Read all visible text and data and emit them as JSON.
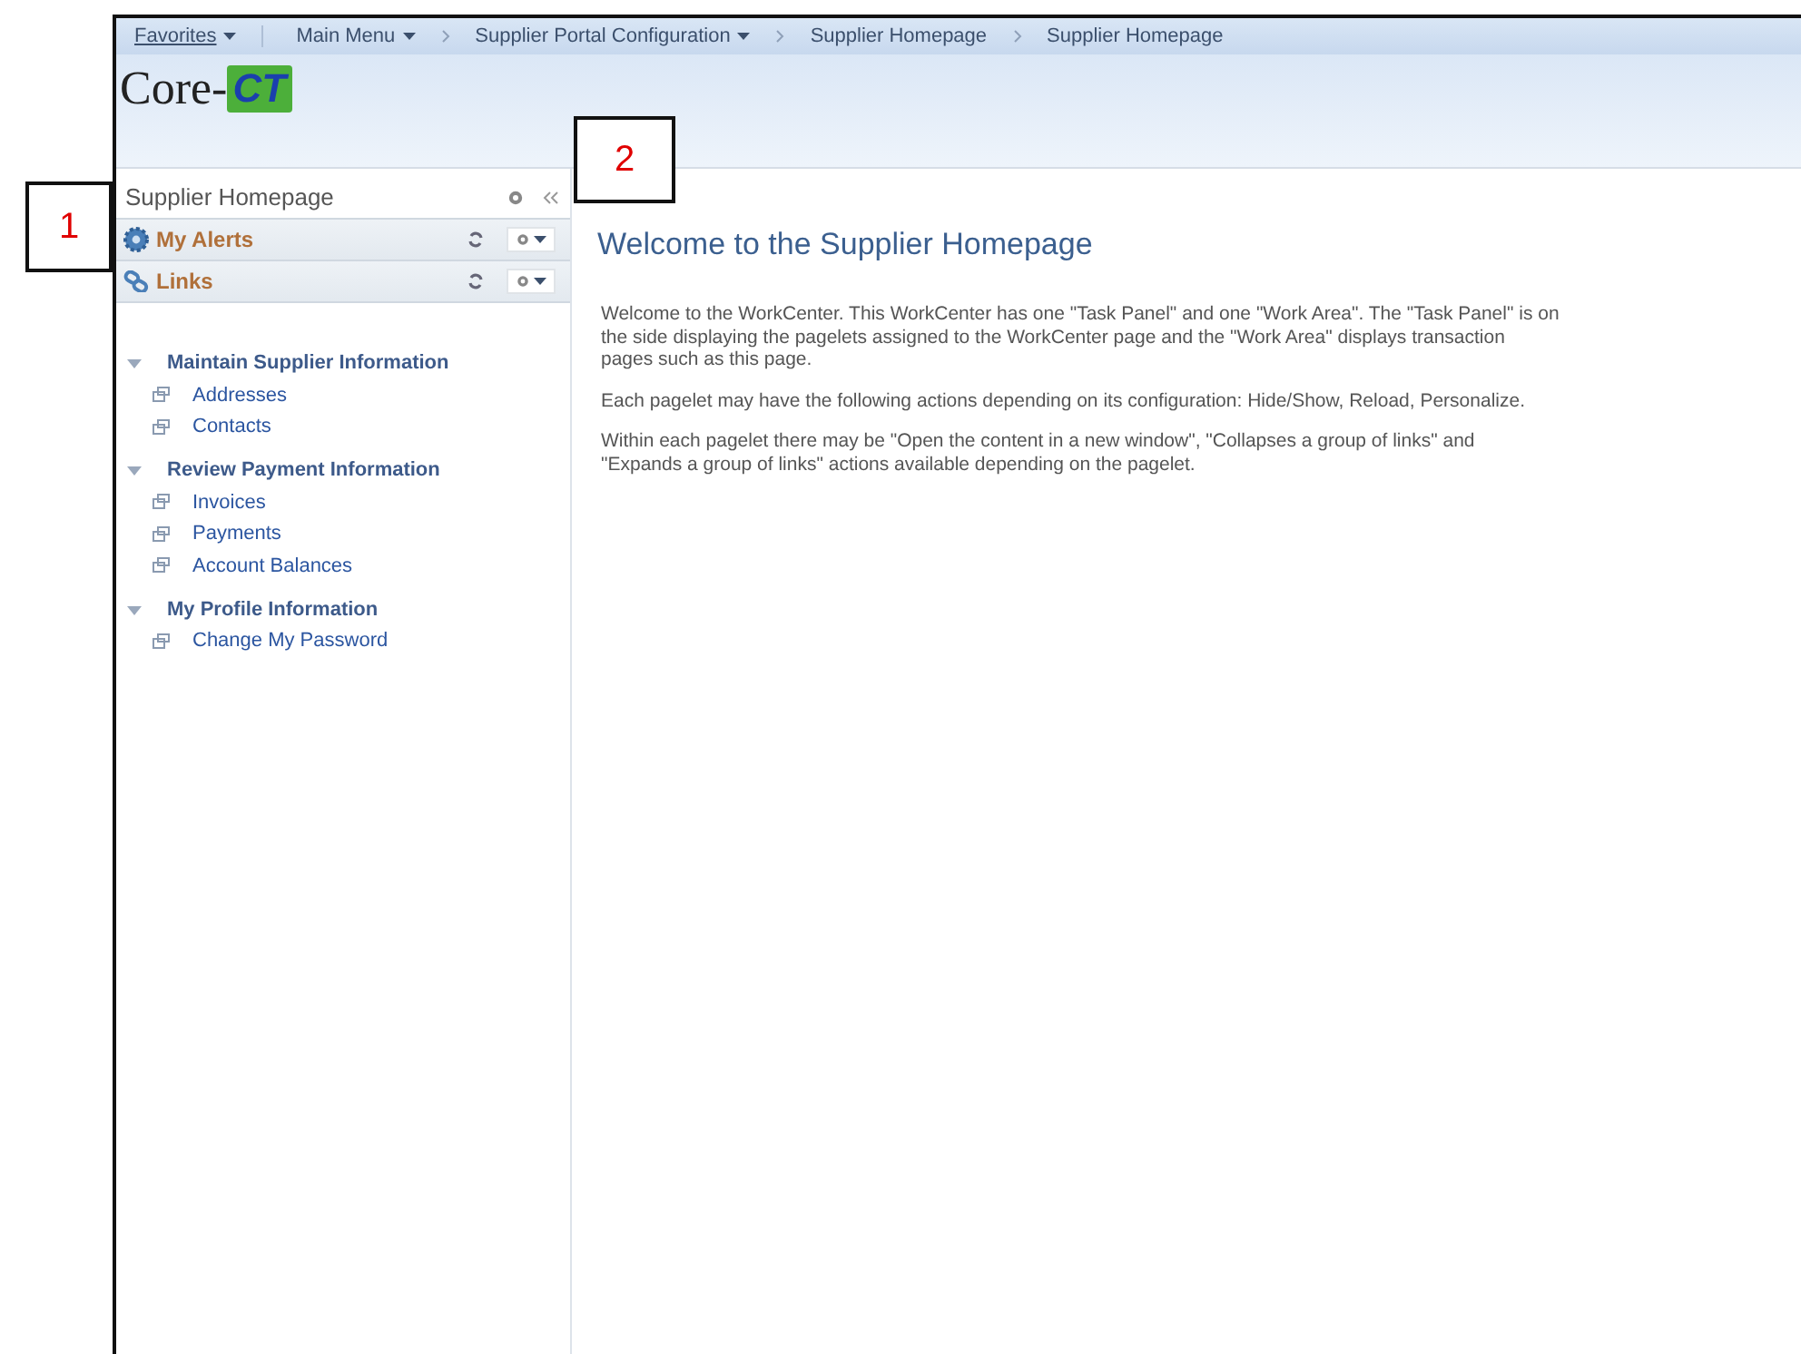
{
  "callouts": [
    {
      "label": "1"
    },
    {
      "label": "2"
    }
  ],
  "breadcrumbs": [
    {
      "label": "Favorites",
      "kind": "menu",
      "dropdown": true
    },
    {
      "label": "Main Menu",
      "kind": "crumb",
      "dropdown": true
    },
    {
      "label": "Supplier Portal Configuration",
      "kind": "crumb",
      "dropdown": true
    },
    {
      "label": "Supplier Homepage",
      "kind": "crumb",
      "dropdown": false
    },
    {
      "label": "Supplier Homepage",
      "kind": "crumb",
      "dropdown": false
    }
  ],
  "logo": {
    "prefix": "Core-",
    "mark": "CT"
  },
  "panel": {
    "title": "Supplier Homepage",
    "pagelets": [
      {
        "title": "My Alerts",
        "kind": "alerts"
      },
      {
        "title": "Links",
        "kind": "links"
      }
    ],
    "groups": [
      {
        "title": "Maintain Supplier Information",
        "expanded": true,
        "links": [
          "Addresses",
          "Contacts"
        ]
      },
      {
        "title": "Review Payment Information",
        "expanded": true,
        "links": [
          "Invoices",
          "Payments",
          "Account Balances"
        ]
      },
      {
        "title": "My Profile Information",
        "expanded": true,
        "links": [
          "Change My Password"
        ]
      }
    ]
  },
  "main": {
    "heading": "Welcome to the Supplier Homepage",
    "paragraphs": [
      "Welcome to the WorkCenter. This WorkCenter has one \"Task Panel\" and one \"Work Area\". The \"Task Panel\" is on the side displaying the pagelets assigned to the WorkCenter page and the \"Work Area\" displays transaction pages such as this page.",
      "Each pagelet may have the following actions depending on its configuration: Hide/Show, Reload, Personalize.",
      "Within each pagelet there may be \"Open the content in a new window\", \"Collapses a group of links\" and \"Expands a group of links\" actions available depending on the pagelet."
    ]
  }
}
